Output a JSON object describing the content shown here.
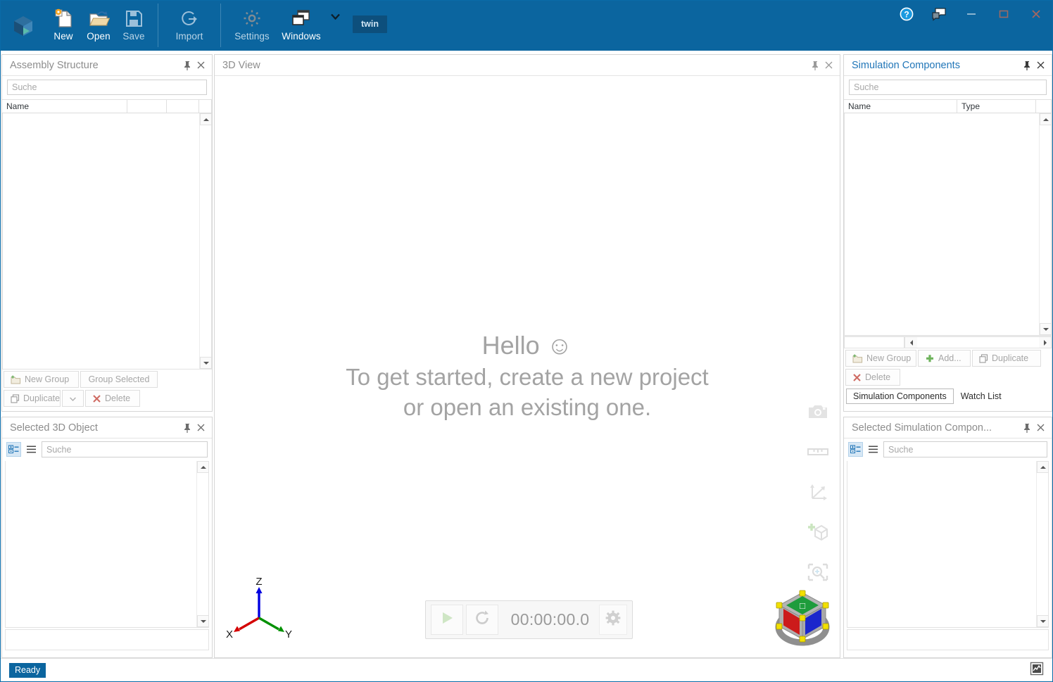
{
  "window": {
    "title": "twin",
    "help_tooltip": "Help",
    "feedback_tooltip": "Feedback",
    "minimize": "–",
    "maximize": "□",
    "close": "✕"
  },
  "ribbon": {
    "logo_name": "app-logo",
    "buttons": [
      {
        "label": "New",
        "icon": "new-document-icon",
        "enabled": true
      },
      {
        "label": "Open",
        "icon": "open-folder-icon",
        "enabled": true
      },
      {
        "label": "Save",
        "icon": "save-disk-icon",
        "enabled": false
      },
      {
        "label": "Import",
        "icon": "import-icon",
        "enabled": false
      },
      {
        "label": "Settings",
        "icon": "gear-icon",
        "enabled": false
      },
      {
        "label": "Windows",
        "icon": "windows-icon",
        "enabled": true
      }
    ],
    "overflow_caret": "▾",
    "badge": "twin"
  },
  "assembly": {
    "title": "Assembly Structure",
    "search_placeholder": "Suche",
    "search_value": "",
    "columns": [
      "Name",
      "",
      "",
      ""
    ],
    "rows": [],
    "buttons": {
      "new_group": "New Group",
      "group_selected": "Group Selected",
      "duplicate": "Duplicate",
      "duplicate_arrow": "▾",
      "delete": "Delete"
    }
  },
  "selected3d": {
    "title": "Selected 3D Object",
    "search_placeholder": "Suche",
    "search_value": "",
    "view_categorized": "categorize-icon",
    "view_alphabetical": "list-icon"
  },
  "view3d": {
    "title": "3D View",
    "welcome_line1": "Hello ☺",
    "welcome_line2": "To get started, create a new project",
    "welcome_line3": "or open an existing one.",
    "tools": [
      {
        "name": "camera-icon",
        "label": "Screenshot"
      },
      {
        "name": "measure-icon",
        "label": "Measure"
      },
      {
        "name": "axes-icon",
        "label": "Coordinate System"
      },
      {
        "name": "add-object-icon",
        "label": "Add Object"
      },
      {
        "name": "zoom-fit-icon",
        "label": "Zoom To Fit"
      }
    ],
    "playback": {
      "play": "play-icon",
      "reset": "reset-icon",
      "time": "00:00:00.0",
      "settings": "gear-icon"
    },
    "axis_triad": {
      "x": "X",
      "y": "Y",
      "z": "Z"
    },
    "navcube_name": "navigation-cube"
  },
  "simcomponents": {
    "title": "Simulation Components",
    "search_placeholder": "Suche",
    "search_value": "",
    "columns": [
      "Name",
      "Type",
      ""
    ],
    "rows": [],
    "buttons": {
      "new_group": "New Group",
      "add": "Add...",
      "duplicate": "Duplicate",
      "delete": "Delete"
    },
    "tabs": [
      {
        "label": "Simulation Components",
        "selected": true
      },
      {
        "label": "Watch List",
        "selected": false
      }
    ]
  },
  "selectedsim": {
    "title": "Selected Simulation Compon...",
    "search_placeholder": "Suche",
    "search_value": "",
    "view_categorized": "categorize-icon",
    "view_alphabetical": "list-icon"
  },
  "statusbar": {
    "message": "Ready",
    "right_icon": "resize-grip-icon"
  },
  "colors": {
    "ribbon": "#0b659f",
    "badge": "#0d4f7c",
    "accent": "#2176b8",
    "axis_x": "#d40000",
    "axis_y": "#009000",
    "axis_z": "#0000e0"
  }
}
